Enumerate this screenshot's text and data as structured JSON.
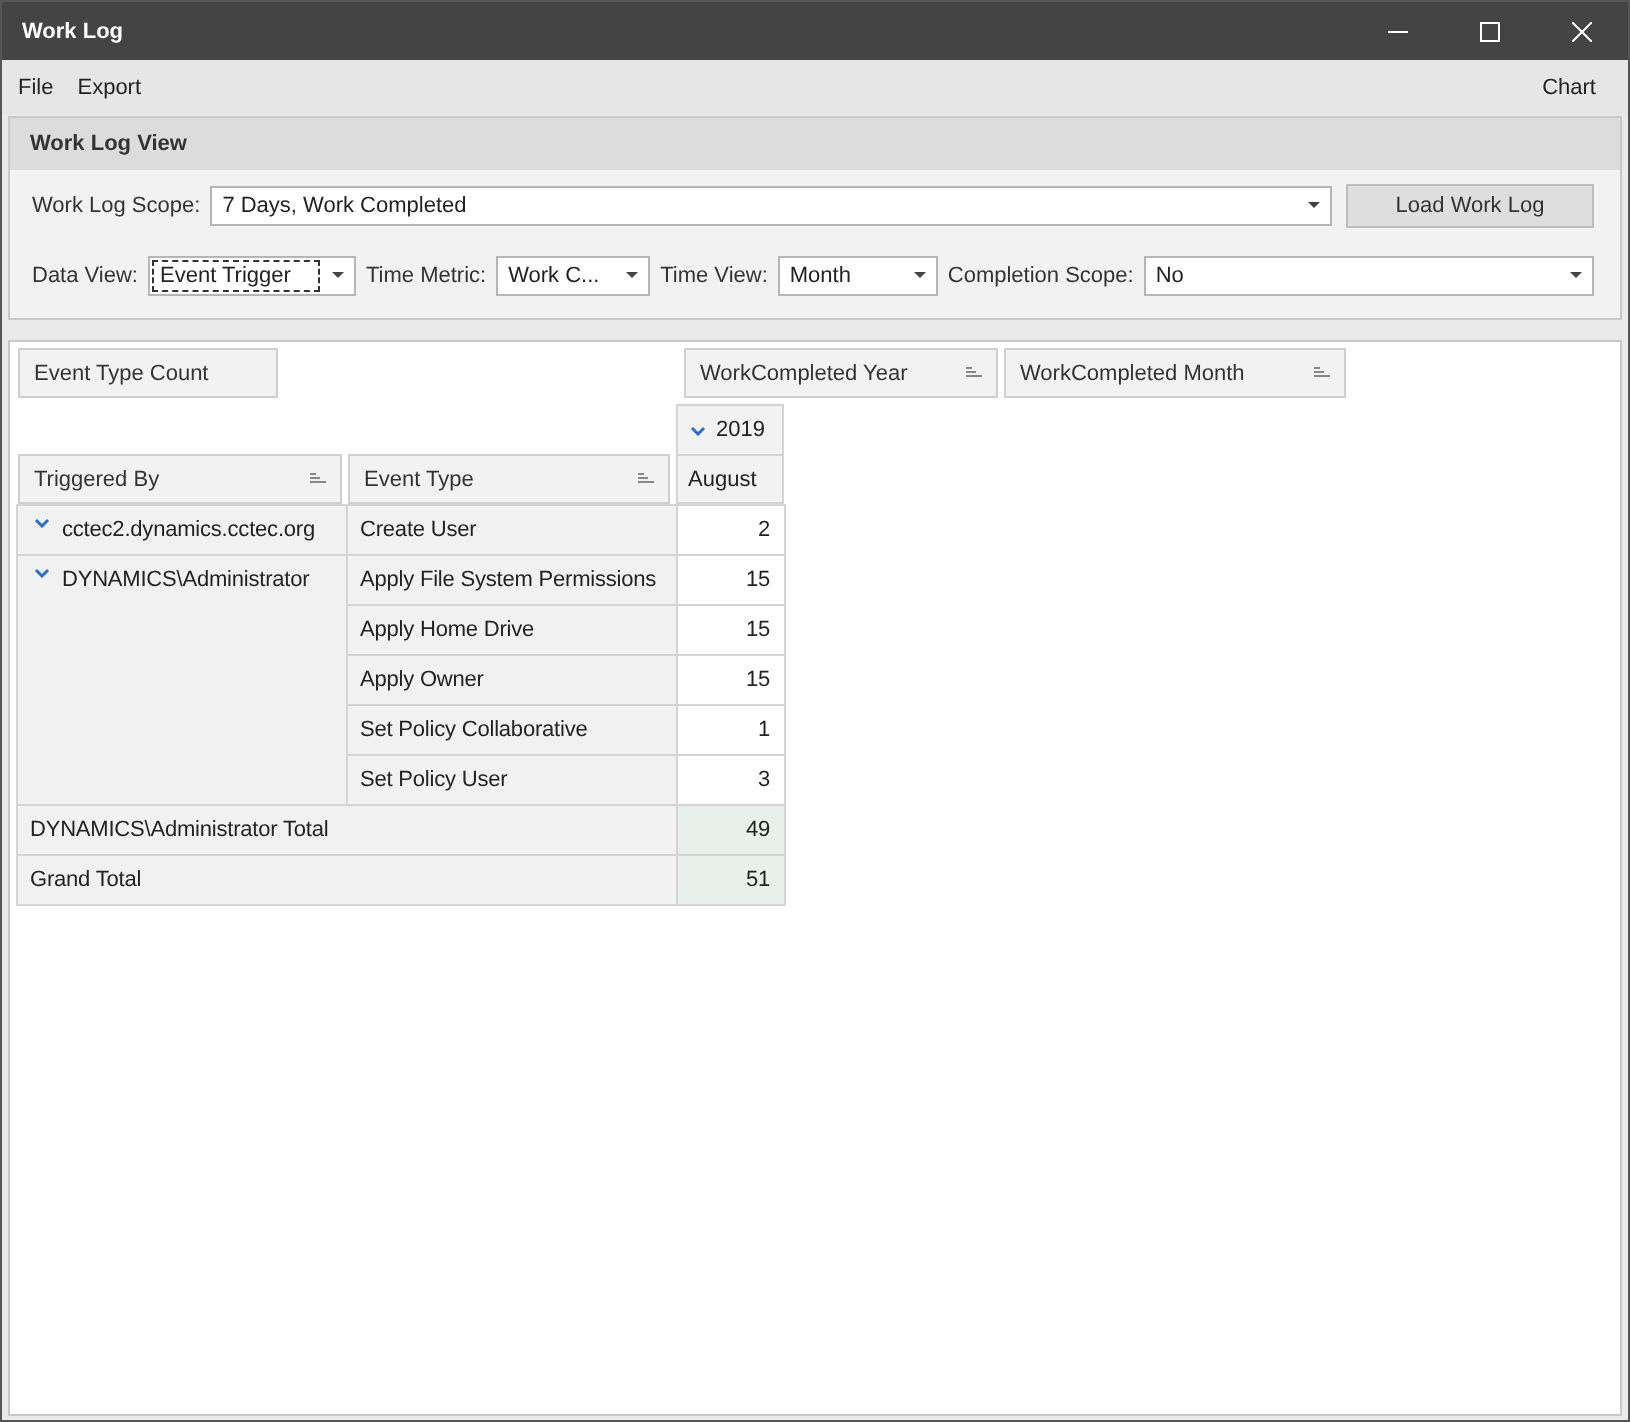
{
  "window": {
    "title": "Work Log"
  },
  "menu": {
    "left": [
      "File",
      "Export"
    ],
    "right": "Chart"
  },
  "panel": {
    "title": "Work Log View",
    "scope": {
      "label": "Work Log Scope:",
      "value": "7 Days, Work Completed"
    },
    "load_button": "Load Work Log",
    "filters": [
      {
        "label": "Data View:",
        "value": "Event Trigger",
        "focused": true
      },
      {
        "label": "Time Metric:",
        "value": "Work C...",
        "focused": false
      },
      {
        "label": "Time View:",
        "value": "Month",
        "focused": false
      },
      {
        "label": "Completion Scope:",
        "value": "No",
        "focused": false
      }
    ]
  },
  "pivot": {
    "data_field": "Event Type Count",
    "column_fields": [
      "WorkCompleted Year",
      "WorkCompleted Month"
    ],
    "row_fields": [
      "Triggered By",
      "Event Type"
    ],
    "year": {
      "label": "2019",
      "expanded": true
    },
    "month": "August",
    "groups": [
      {
        "name": "cctec2.dynamics.cctec.org",
        "expanded": true,
        "rows": [
          {
            "event": "Create User",
            "value": "2"
          }
        ]
      },
      {
        "name": "DYNAMICS\\Administrator",
        "expanded": true,
        "rows": [
          {
            "event": "Apply File System Permissions",
            "value": "15"
          },
          {
            "event": "Apply Home Drive",
            "value": "15"
          },
          {
            "event": "Apply Owner",
            "value": "15"
          },
          {
            "event": "Set Policy Collaborative",
            "value": "1"
          },
          {
            "event": "Set Policy User",
            "value": "3"
          }
        ]
      }
    ],
    "totals": [
      {
        "label": "DYNAMICS\\Administrator Total",
        "value": "49"
      },
      {
        "label": "Grand Total",
        "value": "51"
      }
    ]
  }
}
